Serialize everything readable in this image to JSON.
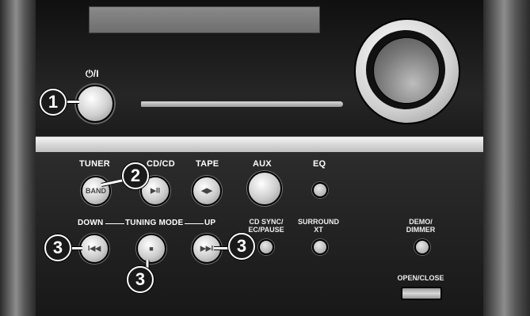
{
  "power": {
    "symbol": "⏻/I",
    "callout": "1"
  },
  "row1": {
    "tuner": {
      "label": "TUNER",
      "button_text": "BAND"
    },
    "cd": {
      "label": "CD/CD",
      "button_text": "▶II",
      "callout": "2"
    },
    "tape": {
      "label": "TAPE",
      "button_text": "◀▶"
    },
    "aux": {
      "label": "AUX"
    },
    "eq": {
      "label": "EQ"
    }
  },
  "row2": {
    "down": {
      "label": "DOWN",
      "button_text": "I◀◀",
      "callout": "3"
    },
    "tuning_mode": {
      "label": "TUNING MODE",
      "button_text": "■",
      "callout": "3"
    },
    "up": {
      "label": "UP",
      "button_text": "▶▶I",
      "callout": "3"
    },
    "cd_sync": {
      "label_line1": "CD SYNC/",
      "label_line2": "EC/PAUSE"
    },
    "surround": {
      "label_line1": "SURROUND",
      "label_line2": "XT"
    },
    "demo": {
      "label_line1": "DEMO/",
      "label_line2": "DIMMER"
    }
  },
  "open_close": {
    "label": "OPEN/CLOSE"
  }
}
